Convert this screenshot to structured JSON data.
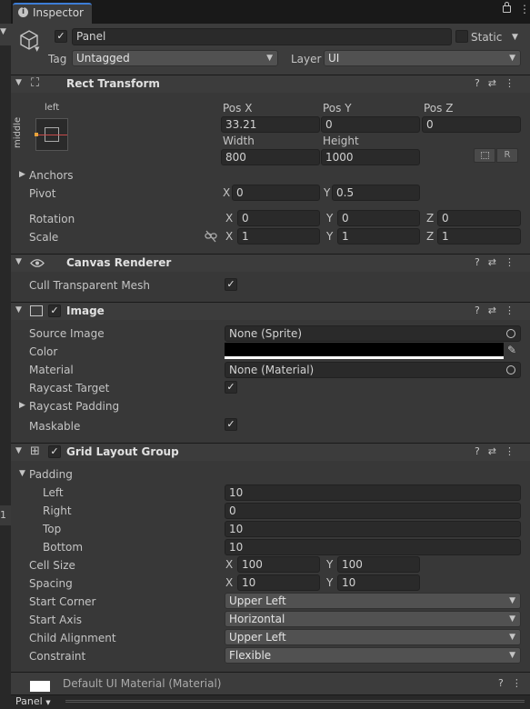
{
  "tab": {
    "title": "Inspector"
  },
  "object": {
    "name": "Panel",
    "static_label": "Static",
    "tag_label": "Tag",
    "tag_value": "Untagged",
    "layer_label": "Layer",
    "layer_value": "UI"
  },
  "rect_transform": {
    "title": "Rect Transform",
    "anchor_h": "left",
    "anchor_v": "middle",
    "pos_x_label": "Pos X",
    "pos_y_label": "Pos Y",
    "pos_z_label": "Pos Z",
    "pos_x": "33.21",
    "pos_y": "0",
    "pos_z": "0",
    "width_label": "Width",
    "height_label": "Height",
    "width": "800",
    "height": "1000",
    "r_button": "R",
    "anchors_label": "Anchors",
    "pivot_label": "Pivot",
    "pivot_x": "0",
    "pivot_y": "0.5",
    "rotation_label": "Rotation",
    "rot_x": "0",
    "rot_y": "0",
    "rot_z": "0",
    "scale_label": "Scale",
    "scale_x": "1",
    "scale_y": "1",
    "scale_z": "1",
    "x": "X",
    "y": "Y",
    "z": "Z"
  },
  "canvas_renderer": {
    "title": "Canvas Renderer",
    "cull_label": "Cull Transparent Mesh",
    "cull_checked": "✓"
  },
  "image": {
    "title": "Image",
    "source_label": "Source Image",
    "source_value": "None (Sprite)",
    "color_label": "Color",
    "color_value": "#000000",
    "material_label": "Material",
    "material_value": "None (Material)",
    "raycast_target_label": "Raycast Target",
    "raycast_padding_label": "Raycast Padding",
    "maskable_label": "Maskable",
    "check": "✓"
  },
  "grid": {
    "title": "Grid Layout Group",
    "padding_label": "Padding",
    "left_label": "Left",
    "left": "10",
    "right_label": "Right",
    "right": "0",
    "top_label": "Top",
    "top": "10",
    "bottom_label": "Bottom",
    "bottom": "10",
    "cell_label": "Cell Size",
    "cell_x": "100",
    "cell_y": "100",
    "spacing_label": "Spacing",
    "spacing_x": "10",
    "spacing_y": "10",
    "start_corner_label": "Start Corner",
    "start_corner": "Upper Left",
    "start_axis_label": "Start Axis",
    "start_axis": "Horizontal",
    "child_align_label": "Child Alignment",
    "child_align": "Upper Left",
    "constraint_label": "Constraint",
    "constraint": "Flexible"
  },
  "material_footer": {
    "title": "Default UI Material (Material)"
  },
  "bottom_bar": {
    "label": "Panel"
  },
  "side": {
    "item": "1"
  }
}
